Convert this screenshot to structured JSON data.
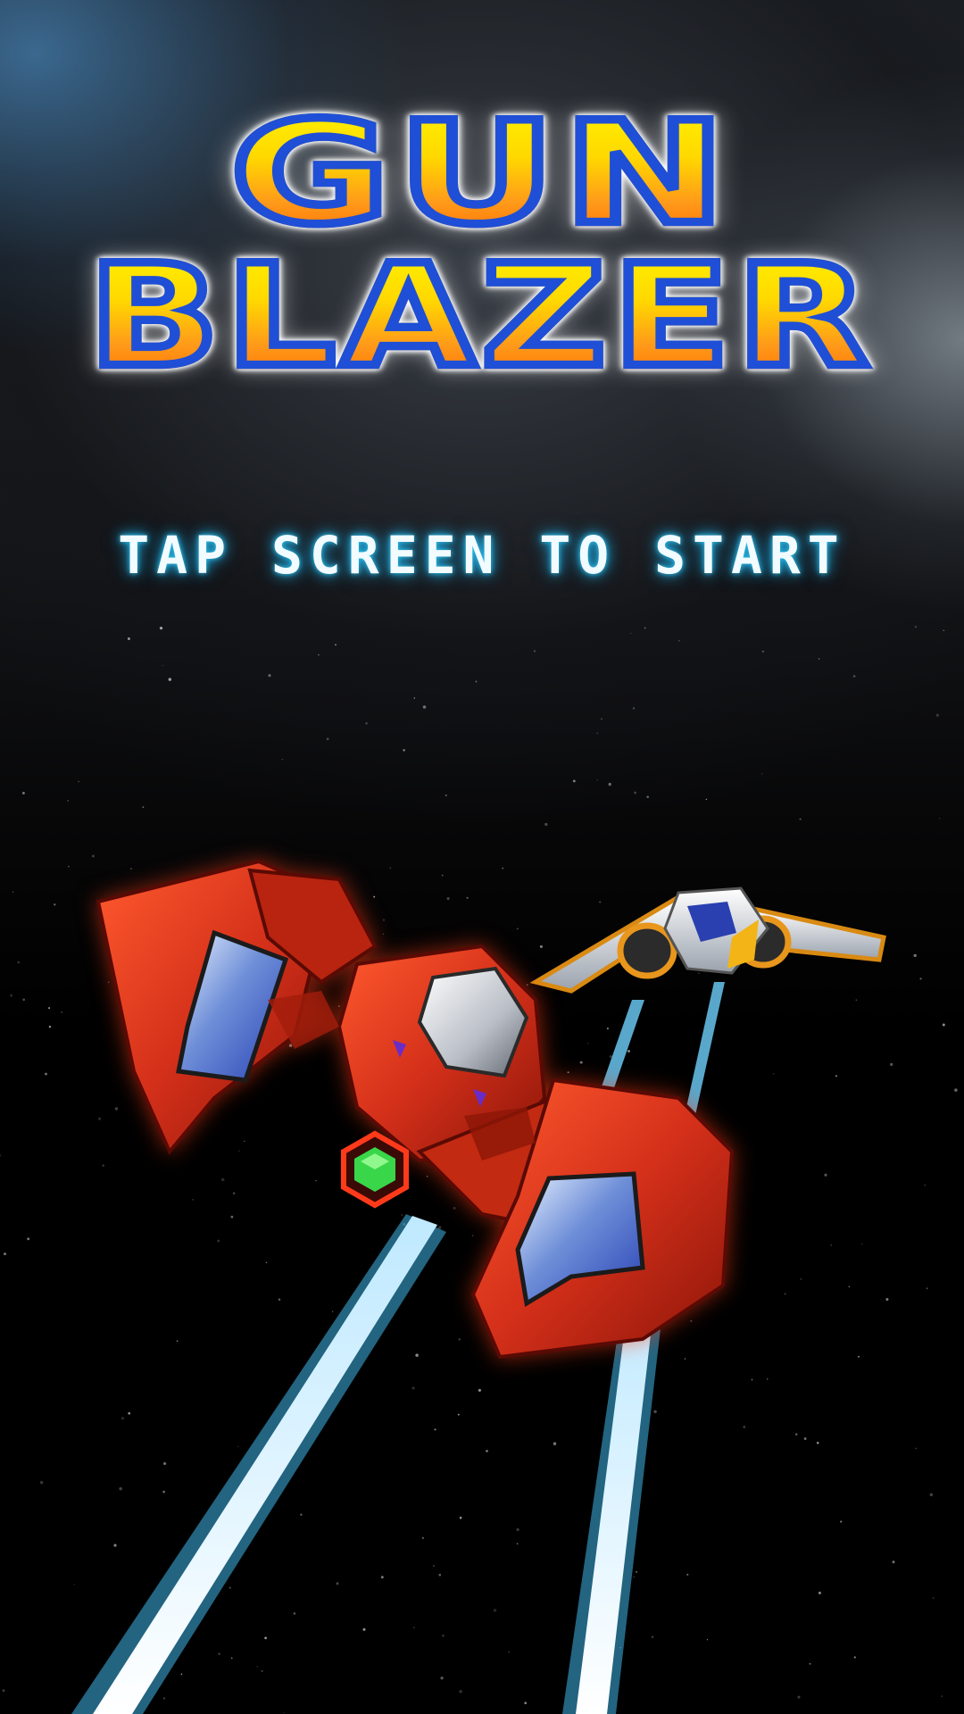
{
  "logo": {
    "line1": "GUN",
    "line2": "BLAZER"
  },
  "prompt": {
    "text": "TAP SCREEN TO START"
  },
  "icons": {
    "player_ship": "red-fighter-ship-icon",
    "wingman_ship": "silver-orange-wingman-ship-icon",
    "thrust_trails": "blue-light-trail-icon",
    "core": "green-hexagon-core-icon"
  },
  "colors": {
    "logo_fill_top": "#fff200",
    "logo_fill_bottom": "#ff6a00",
    "logo_outline": "#1f4fd6",
    "prompt_glow": "#2fc7f2",
    "ship_red": "#d4301a",
    "trail_blue": "#3fb6ea",
    "core_green": "#39d64a"
  }
}
